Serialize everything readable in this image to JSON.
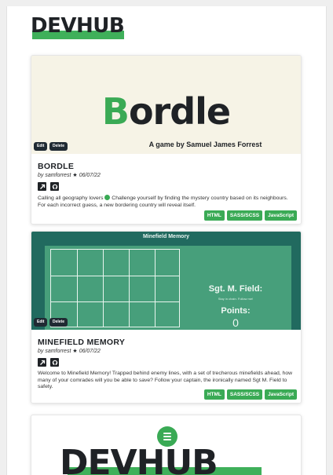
{
  "brand": {
    "logo_text": "DEVHUB"
  },
  "cards": [
    {
      "thumb_title_first": "B",
      "thumb_title_rest": "ordle",
      "thumb_subtitle": "A game by Samuel James Forrest",
      "title": "BORDLE",
      "author": "by samforrest",
      "date": "06/07/22",
      "description_pre": "Calling all geography lovers",
      "description_post": "Challenge yourself by finding the mystery country based on its neighbours. For each incorrect guess, a new bordering country will reveal itself.",
      "edit_label": "Edit",
      "delete_label": "Delete",
      "tags": [
        "HTML",
        "SASS/SCSS",
        "JavaScript"
      ]
    },
    {
      "thumb_header": "Minefield Memory",
      "thumb_sgt": "Sgt. M. Field:",
      "thumb_small": "Stay in chain. Follow me!",
      "thumb_points_label": "Points:",
      "thumb_points_value": "0",
      "title": "MINEFIELD MEMORY",
      "author": "by samforrest",
      "date": "06/07/22",
      "description": "Welcome to Minefield Memory! Trapped behind enemy lines, with a set of trecherous minefields ahead, how many of your comrades will you be able to save? Follow your captain, the ironically named Sgt M. Field to safety.",
      "edit_label": "Edit",
      "delete_label": "Delete",
      "tags": [
        "HTML",
        "SASS/SCSS",
        "JavaScript"
      ]
    },
    {
      "thumb_logo": "DEVHUB"
    }
  ],
  "colors": {
    "accent": "#3aaa55",
    "dark": "#1f2226",
    "minefield_bg": "#216a5f"
  },
  "icons": [
    "external-link-icon",
    "github-icon",
    "star-icon",
    "globe-icon"
  ]
}
